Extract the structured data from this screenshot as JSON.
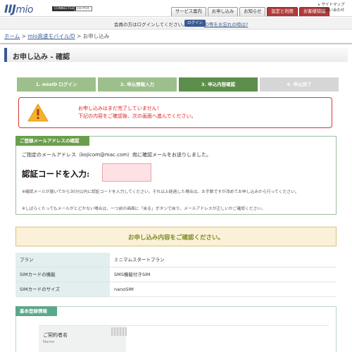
{
  "header": {
    "logo_main": "IIJ",
    "logo_sub": "mio",
    "badge_connected": "CONNECTED",
    "badge_ipv4": "via IPv4",
    "tabs": [
      {
        "label": "サービス案内",
        "style": "normal"
      },
      {
        "label": "お申し込み",
        "style": "normal"
      },
      {
        "label": "お知らせ",
        "style": "normal"
      },
      {
        "label": "設定と利用",
        "style": "red"
      },
      {
        "label": "お客様情報",
        "style": "red"
      }
    ],
    "links": [
      "サイトマップ",
      "お問い合わせ"
    ]
  },
  "loginbar": {
    "message": "会員の方はログインしてください。",
    "login_button": "ログイン",
    "forgot_link": "ID等をお忘れの時は?"
  },
  "breadcrumb": {
    "home": "ホーム",
    "sep": ">",
    "mid": "mio高速モバイル/D",
    "current": "お申し込み"
  },
  "page_title": "お申し込み - 確認",
  "steps": [
    {
      "label": "1. mioID ログイン",
      "state": "done"
    },
    {
      "label": "2. 申込情報入力",
      "state": "done"
    },
    {
      "label": "3. 申込内容確認",
      "state": "active"
    },
    {
      "label": "4. 申込完了",
      "state": "todo"
    }
  ],
  "alert": {
    "line1": "お申し込みはまだ完了していません！",
    "line2": "下記の内容をご確認後、次の画面へ進んでください。",
    "icon": "exclamation-icon"
  },
  "email_section": {
    "label": "ご登録メールアドレスの確認",
    "line1": "ご指定のメールアドレス（kojicom@mac.com）宛に確認メールをお送りしました。",
    "code_label": "認証コードを入力:",
    "code_value": "",
    "note1": "※確認メールが届いてから30分以内に認証コードを入力してください。それ以上経過した場合は、お手数ですが改めてお申し込みから行ってください。",
    "note2": "※しばらくたってもメールがとどかない場合は、一つ前の画面に「戻る」ボタンで戻り、メールアドレスが正しいかご確認ください。"
  },
  "confirm_banner": "お申し込み内容をご確認ください。",
  "order_table": [
    {
      "label": "プラン",
      "value": "ミニマムスタートプラン"
    },
    {
      "label": "SIMカードの機能",
      "value": "SMS機能付きSIM"
    },
    {
      "label": "SIMカードのサイズ",
      "value": "nanoSIM"
    }
  ],
  "basic_section": {
    "label": "基本登録情報",
    "contract_label": "ご契約者名",
    "contract_sub": "Name"
  },
  "colors": {
    "brand": "#3a5a92",
    "step_done": "#9dbf8b",
    "step_active": "#5c8f4b",
    "alert": "#dd2222",
    "section_green": "#6a9e4c",
    "section_teal": "#5aa88b"
  }
}
